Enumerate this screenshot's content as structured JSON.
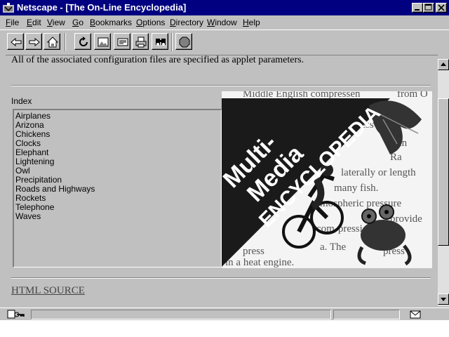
{
  "window": {
    "app_name": "Netscape",
    "title": "Netscape - [The On-Line Encyclopedia]"
  },
  "menu": [
    {
      "label": "File",
      "key": "F",
      "rest": "ile"
    },
    {
      "label": "Edit",
      "key": "E",
      "rest": "dit"
    },
    {
      "label": "View",
      "key": "V",
      "rest": "iew"
    },
    {
      "label": "Go",
      "key": "G",
      "rest": "o"
    },
    {
      "label": "Bookmarks",
      "key": "B",
      "rest": "ookmarks"
    },
    {
      "label": "Options",
      "key": "O",
      "rest": "ptions"
    },
    {
      "label": "Directory",
      "key": "D",
      "rest": "irectory"
    },
    {
      "label": "Window",
      "key": "W",
      "rest": "indow"
    },
    {
      "label": "Help",
      "key": "H",
      "rest": "elp"
    }
  ],
  "toolbar": {
    "buttons": [
      "back-icon",
      "forward-icon",
      "home-icon",
      "reload-icon",
      "images-icon",
      "open-icon",
      "print-icon",
      "find-icon",
      "stop-icon"
    ]
  },
  "page": {
    "top_text": "All of the associated configuration files are specified as applet parameters.",
    "index_label": "Index",
    "index_items": [
      "Airplanes",
      "Arizona",
      "Chickens",
      "Clocks",
      "Elephant",
      "Lightening",
      "Owl",
      "Precipitation",
      "Roads and Highways",
      "Rockets",
      "Telephone",
      "Waves"
    ],
    "banner": {
      "line1": "Multi-",
      "line2": "Media",
      "line3": "ENCYCLOPEDIA",
      "bg_text": [
        "Middle English compressen",
        "from O",
        "compress",
        "cn",
        "Ra",
        "laterally or length",
        "many fish.",
        "mospheric pressure",
        "provide",
        "com-pression",
        "com",
        "ion",
        "press",
        "a. The",
        "press",
        "in a heat engine."
      ]
    },
    "html_source_link": "HTML SOURCE"
  },
  "colors": {
    "titlebar": "#000080",
    "chrome": "#c0c0c0",
    "banner_dark": "#1a1a1a"
  }
}
